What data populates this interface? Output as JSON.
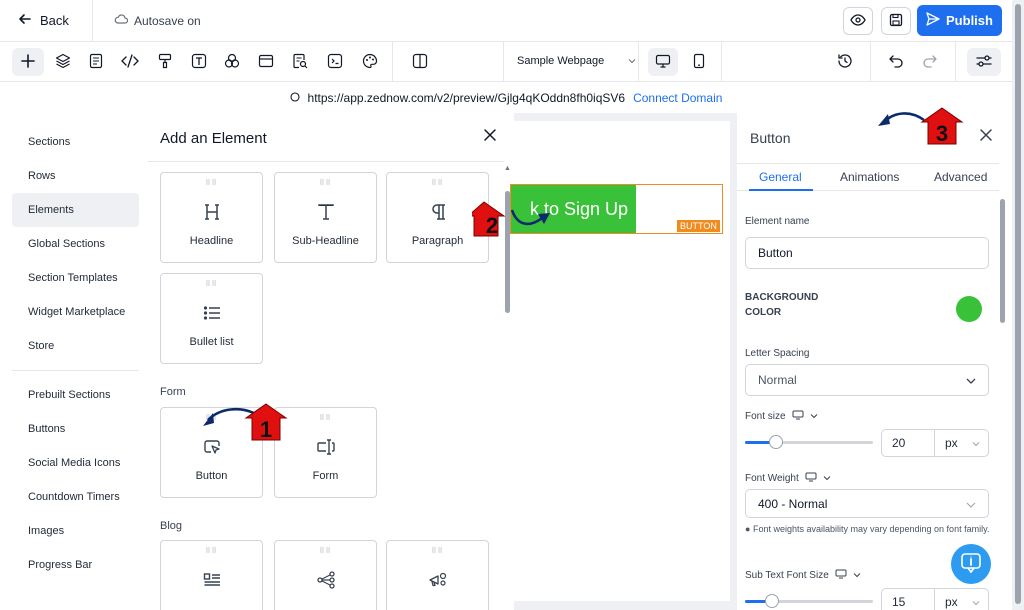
{
  "topbar": {
    "back_label": "Back",
    "autosave_label": "Autosave on",
    "publish_label": "Publish"
  },
  "toolbar": {
    "page_select": "Sample Webpage"
  },
  "urlbar": {
    "url": "https://app.zednow.com/v2/preview/Gjlg4qKOddn8fh0iqSV6",
    "connect_label": "Connect Domain"
  },
  "leftnav": {
    "items": [
      "Sections",
      "Rows",
      "Elements",
      "Global Sections",
      "Section Templates",
      "Widget Marketplace",
      "Store"
    ],
    "items2": [
      "Prebuilt Sections",
      "Buttons",
      "Social Media Icons",
      "Countdown Timers",
      "Images",
      "Progress Bar"
    ],
    "active": "Elements"
  },
  "addpanel": {
    "title": "Add an Element",
    "cards_text": [
      "Headline",
      "Sub-Headline",
      "Paragraph",
      "Bullet list"
    ],
    "section_form": "Form",
    "cards_form": [
      "Button",
      "Form"
    ],
    "section_blog": "Blog"
  },
  "canvas": {
    "button_text": "k to Sign Up",
    "tag": "BUTTON"
  },
  "rightpanel": {
    "title": "Button",
    "tabs": [
      "General",
      "Animations",
      "Advanced"
    ],
    "element_name_label": "Element name",
    "element_name_value": "Button",
    "bg_color_label_1": "BACKGROUND",
    "bg_color_label_2": "COLOR",
    "bg_color": "#3ac13a",
    "letter_spacing_label": "Letter Spacing",
    "letter_spacing_value": "Normal",
    "font_size_label": "Font size",
    "font_size_value": "20",
    "font_size_unit": "px",
    "font_weight_label": "Font Weight",
    "font_weight_value": "400 - Normal",
    "font_weight_note": "Font weights availability may vary depending on font family.",
    "sub_font_size_label": "Sub Text Font Size",
    "sub_font_size_value": "15",
    "sub_font_size_unit": "px"
  },
  "annotations": [
    "1",
    "2",
    "3"
  ],
  "colors": {
    "accent": "#1e6ff0",
    "button_green": "#3ac13a",
    "outline_orange": "#f08c1e",
    "annotation_red": "#e01010",
    "annotation_arrow": "#0d2a6b"
  }
}
